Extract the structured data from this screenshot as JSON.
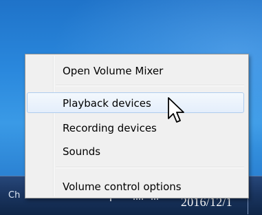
{
  "taskbar": {
    "language_indicator": "Ch",
    "clock_date": "2016/12/1"
  },
  "context_menu": {
    "items": [
      {
        "label": "Open Volume Mixer"
      },
      {
        "label": "Playback devices"
      },
      {
        "label": "Recording devices"
      },
      {
        "label": "Sounds"
      },
      {
        "label": "Volume control options"
      }
    ],
    "hovered_item": "Playback devices"
  },
  "cursor": {
    "icon": "arrow-pointer-icon"
  }
}
